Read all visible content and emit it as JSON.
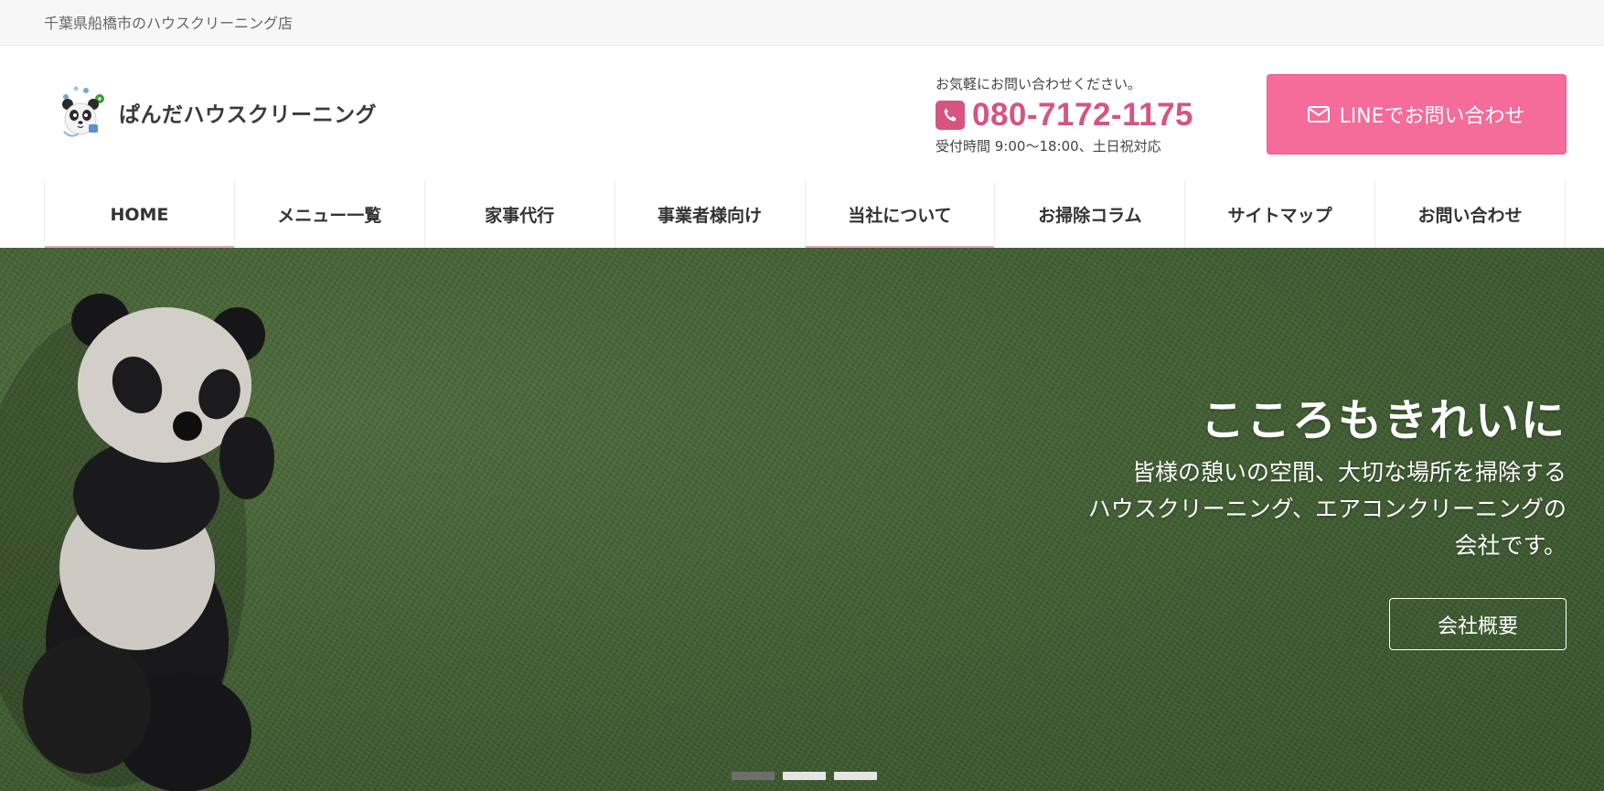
{
  "topbar": {
    "tagline": "千葉県船橋市のハウスクリーニング店"
  },
  "header": {
    "logo_text": "ぱんだハウスクリーニング",
    "contact_note": "お気軽にお問い合わせください。",
    "phone": "080-7172-1175",
    "hours": "受付時間 9:00〜18:00、土日祝対応",
    "line_button": "LINEでお問い合わせ",
    "icons": {
      "phone": "phone-icon",
      "line": "envelope-icon",
      "logo": "panda-logo-icon"
    }
  },
  "nav": {
    "items": [
      {
        "label": "HOME"
      },
      {
        "label": "メニュー一覧"
      },
      {
        "label": "家事代行"
      },
      {
        "label": "事業者様向け"
      },
      {
        "label": "当社について"
      },
      {
        "label": "お掃除コラム"
      },
      {
        "label": "サイトマップ"
      },
      {
        "label": "お問い合わせ"
      }
    ]
  },
  "hero": {
    "title": "こころもきれいに",
    "subtitle_lines": [
      "皆様の憩いの空間、大切な場所を掃除する",
      "ハウスクリーニング、エアコンクリーニングの",
      "会社です。"
    ],
    "button": "会社概要",
    "slides_total": 3,
    "active_slide": 1
  },
  "colors": {
    "accent_pink": "#d6547f",
    "line_button_bg": "#f56b99",
    "topbar_bg": "#f7f7f7",
    "hero_grass": "#4f6e3e"
  }
}
